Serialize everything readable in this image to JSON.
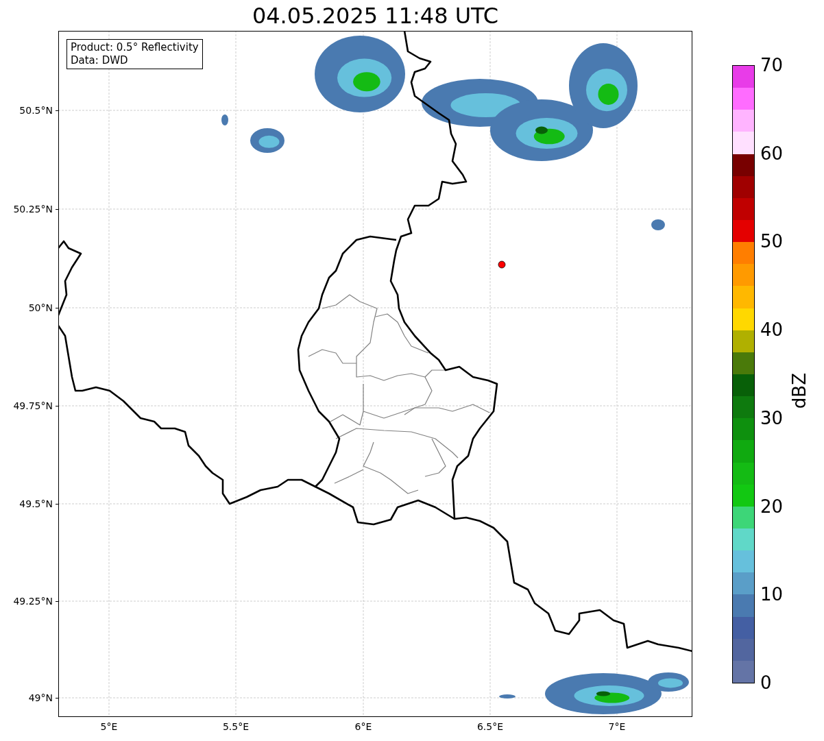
{
  "title": "04.05.2025 11:48 UTC",
  "info_box": {
    "lines": [
      "Product: 0.5° Reflectivity",
      "Data: DWD"
    ]
  },
  "map": {
    "y_ticks": [
      "50.5°N",
      "50.25°N",
      "50°N",
      "49.75°N",
      "49.5°N",
      "49.25°N",
      "49°N"
    ],
    "x_ticks": [
      "5°E",
      "5.5°E",
      "6°E",
      "6.5°E",
      "7°E"
    ]
  },
  "colorbar": {
    "label": "dBZ",
    "ticks": [
      "70",
      "60",
      "50",
      "40",
      "30",
      "20",
      "10",
      "0"
    ],
    "bands": [
      {
        "color": "#6474a6"
      },
      {
        "color": "#52669f"
      },
      {
        "color": "#445fa3"
      },
      {
        "color": "#4a7ab0"
      },
      {
        "color": "#5a9ec8"
      },
      {
        "color": "#66c0dc"
      },
      {
        "color": "#60d8c8"
      },
      {
        "color": "#3dd678"
      },
      {
        "color": "#12c812"
      },
      {
        "color": "#14bb14"
      },
      {
        "color": "#10aa10"
      },
      {
        "color": "#0e900e"
      },
      {
        "color": "#0e7a0e"
      },
      {
        "color": "#086008"
      },
      {
        "color": "#4a7a0a"
      },
      {
        "color": "#b0b000"
      },
      {
        "color": "#ffd800"
      },
      {
        "color": "#ffb800"
      },
      {
        "color": "#ff9a00"
      },
      {
        "color": "#ff7e00"
      },
      {
        "color": "#e40000"
      },
      {
        "color": "#c00000"
      },
      {
        "color": "#a00000"
      },
      {
        "color": "#780000"
      },
      {
        "color": "#ffe0ff"
      },
      {
        "color": "#ffb4ff"
      },
      {
        "color": "#ff6cff"
      },
      {
        "color": "#e83ce8"
      }
    ]
  }
}
